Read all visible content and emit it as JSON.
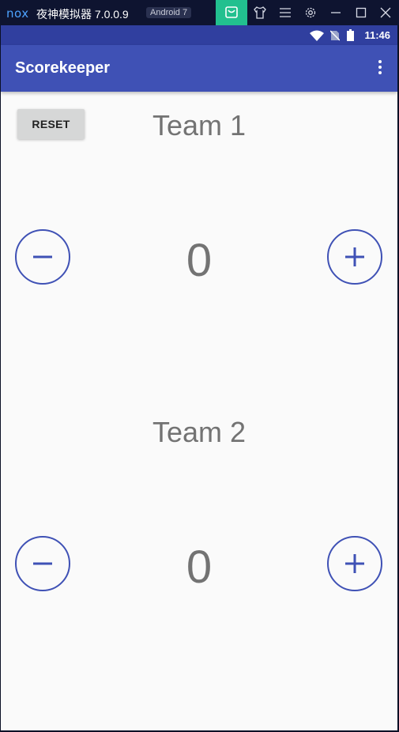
{
  "emulator": {
    "logo": "nox",
    "title": "夜神模拟器 7.0.0.9",
    "badge": "Android 7",
    "icons": [
      "store-icon",
      "shirt-icon",
      "menu-icon",
      "settings-icon",
      "minimize-icon",
      "maximize-icon",
      "close-icon"
    ]
  },
  "status_bar": {
    "time": "11:46",
    "icons": [
      "wifi-icon",
      "no-sim-icon",
      "battery-icon"
    ]
  },
  "app_bar": {
    "title": "Scorekeeper",
    "menu_icon": "more-vert-icon"
  },
  "reset_label": "RESET",
  "teams": [
    {
      "name": "Team 1",
      "score": "0"
    },
    {
      "name": "Team 2",
      "score": "0"
    }
  ],
  "colors": {
    "primary": "#3f51b5",
    "primary_dark": "#303f9f",
    "text_gray": "#737373",
    "background": "#fafafa"
  }
}
